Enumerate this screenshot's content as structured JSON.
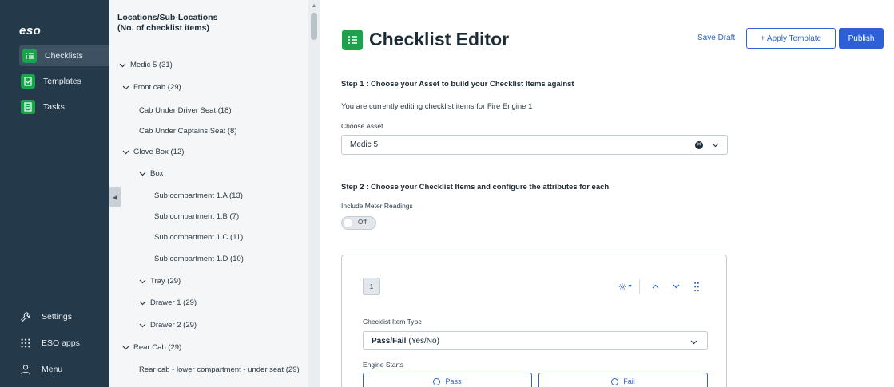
{
  "nav": {
    "logo": "eso",
    "items": [
      {
        "label": "Checklists",
        "active": true
      },
      {
        "label": "Templates",
        "active": false
      },
      {
        "label": "Tasks",
        "active": false
      }
    ],
    "bottom": [
      {
        "label": "Settings",
        "icon": "wrench-icon"
      },
      {
        "label": "ESO apps",
        "icon": "grid-icon"
      },
      {
        "label": "Menu",
        "icon": "user-icon"
      }
    ],
    "accent": "#1aa34a"
  },
  "tree": {
    "title_line1": "Locations/Sub-Locations",
    "title_line2": "(No. of checklist items)",
    "items": [
      {
        "label": "Medic 5 (31)",
        "level": 0,
        "expandable": true
      },
      {
        "label": "Front cab (29)",
        "level": 1,
        "expandable": true
      },
      {
        "label": "Cab Under Driver Seat (18)",
        "level": 2,
        "expandable": false
      },
      {
        "label": "Cab Under Captains Seat (8)",
        "level": 2,
        "expandable": false
      },
      {
        "label": "Glove Box (12)",
        "level": 1,
        "expandable": true
      },
      {
        "label": "Box",
        "level": 2,
        "expandable": true
      },
      {
        "label": "Sub compartment 1.A (13)",
        "level": 3,
        "expandable": false
      },
      {
        "label": "Sub compartment 1.B (7)",
        "level": 3,
        "expandable": false
      },
      {
        "label": "Sub compartment 1.C (11)",
        "level": 3,
        "expandable": false
      },
      {
        "label": "Sub compartment 1.D (10)",
        "level": 3,
        "expandable": false
      },
      {
        "label": "Tray (29)",
        "level": 2,
        "expandable": true
      },
      {
        "label": "Drawer 1 (29)",
        "level": 2,
        "expandable": true
      },
      {
        "label": "Drawer 2 (29)",
        "level": 2,
        "expandable": true
      },
      {
        "label": "Rear Cab (29)",
        "level": 1,
        "expandable": true
      },
      {
        "label": "Rear cab - lower compartment - under seat  (29)",
        "level": 2,
        "expandable": false
      }
    ]
  },
  "header": {
    "title": "Checklist Editor",
    "save_draft": "Save Draft",
    "apply_template": "+ Apply Template",
    "publish": "Publish"
  },
  "step1": {
    "heading": "Step 1 : Choose your Asset to build your Checklist Items against",
    "editing_text": "You are currently editing checklist items for Fire Engine 1",
    "choose_asset_label": "Choose Asset",
    "asset_value": "Medic 5"
  },
  "step2": {
    "heading": "Step 2 : Choose your Checklist Items and configure the attributes for each",
    "meter_label": "Include Meter Readings",
    "toggle_text": "Off"
  },
  "card": {
    "number": "1",
    "type_label": "Checklist Item Type",
    "type_value_bold": "Pass/Fail",
    "type_value_rest": "(Yes/No)",
    "item_label": "Engine Starts",
    "pass": "Pass",
    "fail": "Fail"
  }
}
